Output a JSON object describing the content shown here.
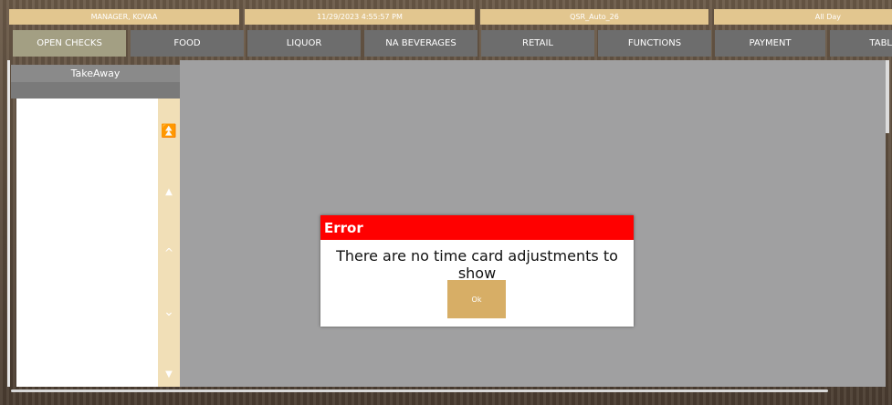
{
  "header": {
    "user": "MANAGER, KOVAA",
    "datetime": "11/29/2023 4:55:57 PM",
    "terminal": "QSR_Auto_26",
    "daypart": "All Day"
  },
  "nav": {
    "open_checks": "OPEN CHECKS",
    "food": "FOOD",
    "liquor": "LIQUOR",
    "na_beverages": "NA BEVERAGES",
    "retail": "RETAIL",
    "functions": "FUNCTIONS",
    "payment": "PAYMENT",
    "tables": "TABL"
  },
  "panel": {
    "title": "TakeAway"
  },
  "scroll": {
    "top_glyph": "⏫",
    "page_up_glyph": "▲",
    "up_glyph": "^",
    "down_glyph": "⌄",
    "page_down_glyph": "▼"
  },
  "dialog": {
    "title": "Error",
    "message": "There are no time card adjustments to show",
    "ok_label": "Ok"
  },
  "colors": {
    "info_bar": "#e2c68f",
    "nav_active": "#a39f83",
    "nav": "#6d6d6d",
    "error": "#ff0000",
    "ok_button": "#d7ae66"
  }
}
